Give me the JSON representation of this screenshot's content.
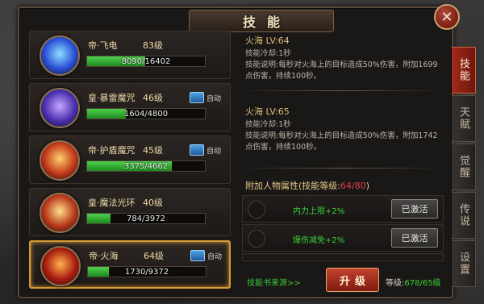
{
  "window": {
    "title": "技能",
    "close_icon": "close-icon"
  },
  "skills": [
    {
      "name": "帝·飞电",
      "level": "83级",
      "exp": "8090/16402",
      "exp_fraction": 0.49,
      "auto": false,
      "auto_label": "",
      "icon": "lightning-orb-icon",
      "colors": [
        "#8de0ff",
        "#2a4fd6"
      ]
    },
    {
      "name": "皇·暴雷魔咒",
      "level": "46级",
      "exp": "1604/4800",
      "exp_fraction": 0.33,
      "auto": true,
      "auto_label": "自动",
      "icon": "thunder-orb-icon",
      "colors": [
        "#c7a7ff",
        "#4a2fb0"
      ]
    },
    {
      "name": "帝·护盾魔咒",
      "level": "45级",
      "exp": "3375/4662",
      "exp_fraction": 0.72,
      "auto": true,
      "auto_label": "自动",
      "icon": "shield-rune-icon",
      "colors": [
        "#ffd06a",
        "#c2391a"
      ]
    },
    {
      "name": "皇·魔法光环",
      "level": "40级",
      "exp": "784/3972",
      "exp_fraction": 0.2,
      "auto": false,
      "auto_label": "",
      "icon": "magic-aura-icon",
      "colors": [
        "#ffe08a",
        "#b8381b"
      ]
    },
    {
      "name": "帝·火海",
      "level": "64级",
      "exp": "1730/9372",
      "exp_fraction": 0.18,
      "auto": true,
      "auto_label": "自动",
      "icon": "fire-sea-icon",
      "colors": [
        "#ffb24a",
        "#a81c10"
      ],
      "selected": true
    }
  ],
  "detail": {
    "current": {
      "title": "火海   LV:64",
      "cooldown": "技能冷却:1秒",
      "desc": "技能说明:每秒对火海上的目标造成50%伤害，附加1699点伤害，持续100秒。"
    },
    "next": {
      "title": "火海   LV:65",
      "cooldown": "技能冷却:1秒",
      "desc": "技能说明:每秒对火海上的目标造成50%伤害，附加1742点伤害，持续100秒。"
    },
    "attr_header": {
      "label": "附加人物属性(技能等级:",
      "ratio": "64/80",
      "close": ")"
    },
    "attributes": [
      {
        "text": "内力上限+2%",
        "button": "已激活"
      },
      {
        "text": "爆伤减免+2%",
        "button": "已激活"
      }
    ],
    "source_link": "技能书来源>>",
    "upgrade_button": "升级",
    "grade": {
      "label": "等级:",
      "value": "678/65级"
    }
  },
  "tabs": [
    {
      "label": "技能",
      "active": true
    },
    {
      "label": "天赋",
      "active": false
    },
    {
      "label": "觉醒",
      "active": false
    },
    {
      "label": "传说",
      "active": false
    },
    {
      "label": "设置",
      "active": false
    }
  ],
  "colors": {
    "accent_gold": "#d69a36",
    "exp_green": "#38d238",
    "tab_red": "#a32a1c"
  }
}
